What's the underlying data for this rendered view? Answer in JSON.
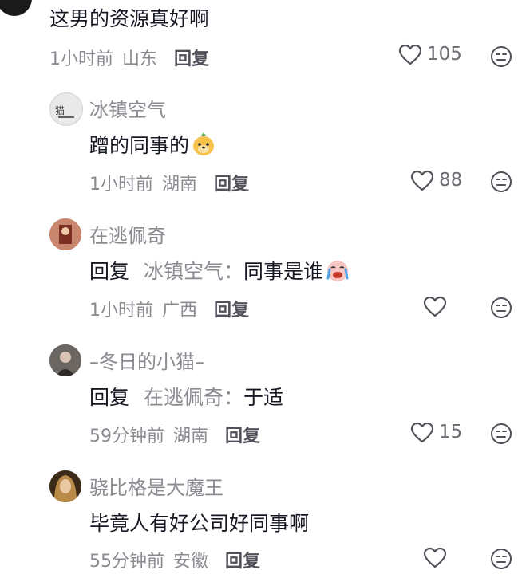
{
  "colors": {
    "text": "#161823",
    "muted": "#8a8b91",
    "reply": "#505159",
    "icon": "#505159"
  },
  "comments": [
    {
      "text": "这男的资源真好啊",
      "time": "1小时前",
      "location": "山东",
      "reply_label": "回复",
      "likes": "105",
      "liked_icon": "heart-outline-icon"
    },
    {
      "user": "冰镇空气",
      "text": "蹭的同事的",
      "emoji": "dog-face-emoji",
      "time": "1小时前",
      "location": "湖南",
      "reply_label": "回复",
      "likes": "88"
    },
    {
      "user": "在逃佩奇",
      "reply_prefix": "回复",
      "reply_to": "冰镇空气：",
      "text": "同事是谁",
      "emoji": "crying-face-emoji",
      "time": "1小时前",
      "location": "广西",
      "reply_label": "回复",
      "likes": ""
    },
    {
      "user": "–冬日的小猫–",
      "reply_prefix": "回复",
      "reply_to": "在逃佩奇：",
      "text": "于适",
      "time": "59分钟前",
      "location": "湖南",
      "reply_label": "回复",
      "likes": "15"
    },
    {
      "user": "骁比格是大魔王",
      "text": "毕竟人有好公司好同事啊",
      "time": "55分钟前",
      "location": "安徽",
      "reply_label": "回复",
      "likes": ""
    }
  ]
}
